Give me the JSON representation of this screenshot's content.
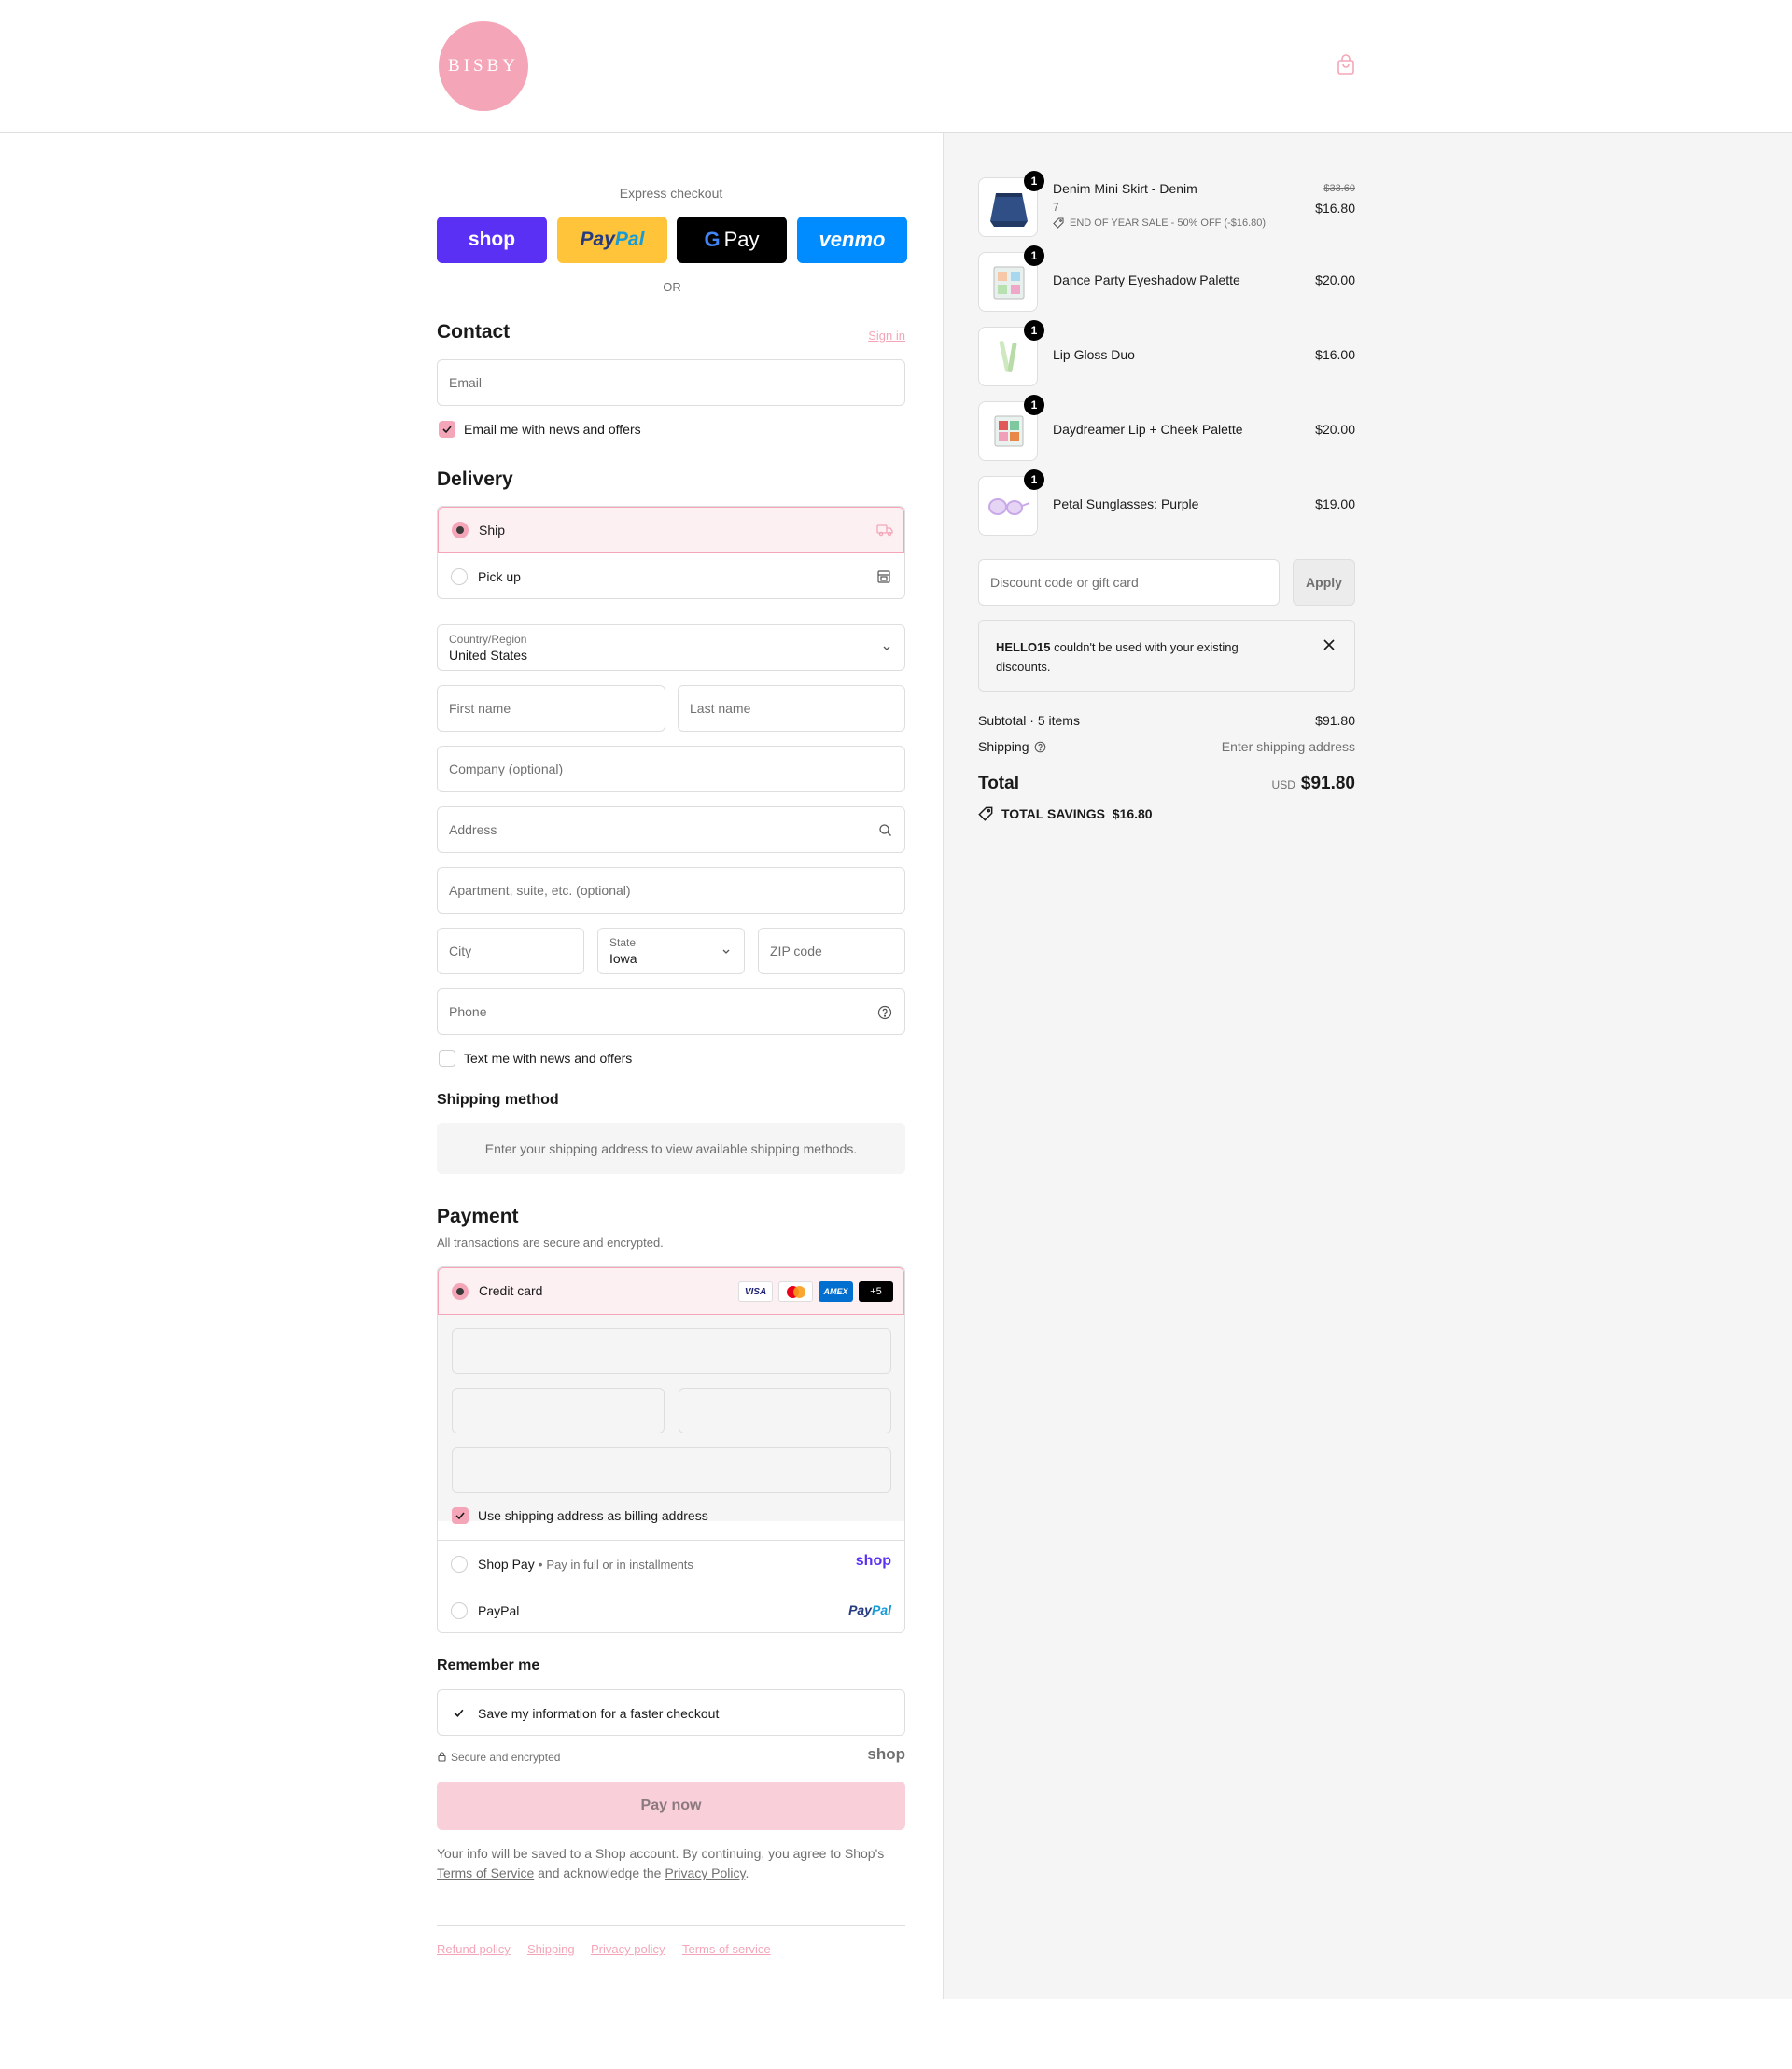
{
  "header": {
    "brand": "BISBY"
  },
  "express": {
    "title": "Express checkout",
    "or": "OR",
    "shop": "shop",
    "paypal_a": "Pay",
    "paypal_b": "Pal",
    "gpay": "Pay",
    "venmo": "venmo"
  },
  "contact": {
    "title": "Contact",
    "sign_in": "Sign in",
    "email_placeholder": "Email",
    "news_label": "Email me with news and offers"
  },
  "delivery": {
    "title": "Delivery",
    "ship": "Ship",
    "pickup": "Pick up",
    "country_label": "Country/Region",
    "country_value": "United States",
    "first_name": "First name",
    "last_name": "Last name",
    "company": "Company (optional)",
    "address": "Address",
    "apartment": "Apartment, suite, etc. (optional)",
    "city": "City",
    "state_label": "State",
    "state_value": "Iowa",
    "zip": "ZIP code",
    "phone": "Phone",
    "text_label": "Text me with news and offers"
  },
  "shipping_method": {
    "title": "Shipping method",
    "message": "Enter your shipping address to view available shipping methods."
  },
  "payment": {
    "title": "Payment",
    "subtitle": "All transactions are secure and encrypted.",
    "credit_card": "Credit card",
    "visa": "VISA",
    "amex": "AMEX",
    "more": "+5",
    "billing_label": "Use shipping address as billing address",
    "shop_pay": "Shop Pay",
    "shop_pay_note": "Pay in full or in installments",
    "shop_logo": "shop",
    "paypal": "PayPal",
    "paypal_a": "Pay",
    "paypal_b": "Pal"
  },
  "remember": {
    "title": "Remember me",
    "save_label": "Save my information for a faster checkout",
    "secure": "Secure and encrypted",
    "shop_logo": "shop"
  },
  "pay_now": "Pay now",
  "legal": {
    "line1": "Your info will be saved to a Shop account. By continuing, you agree to Shop's",
    "tos": "Terms of Service",
    "middle": "and acknowledge the",
    "privacy": "Privacy Policy",
    "end": "."
  },
  "footer_links": [
    "Refund policy",
    "Shipping",
    "Privacy policy",
    "Terms of service"
  ],
  "items": [
    {
      "name": "Denim Mini Skirt - Denim",
      "variant": "7",
      "discount": "END OF YEAR SALE - 50% OFF (-$16.80)",
      "old_price": "$33.60",
      "price": "$16.80",
      "qty": "1"
    },
    {
      "name": "Dance Party Eyeshadow Palette",
      "price": "$20.00",
      "qty": "1"
    },
    {
      "name": "Lip Gloss Duo",
      "price": "$16.00",
      "qty": "1"
    },
    {
      "name": "Daydreamer Lip + Cheek Palette",
      "price": "$20.00",
      "qty": "1"
    },
    {
      "name": "Petal Sunglasses: Purple",
      "price": "$19.00",
      "qty": "1"
    }
  ],
  "discount": {
    "placeholder": "Discount code or gift card",
    "apply": "Apply",
    "code": "HELLO15",
    "error": "couldn't be used with your existing discounts."
  },
  "summary": {
    "subtotal_label": "Subtotal · 5 items",
    "subtotal": "$91.80",
    "shipping_label": "Shipping",
    "shipping_value": "Enter shipping address",
    "total_label": "Total",
    "currency": "USD",
    "total": "$91.80",
    "savings_label": "TOTAL SAVINGS",
    "savings": "$16.80"
  }
}
